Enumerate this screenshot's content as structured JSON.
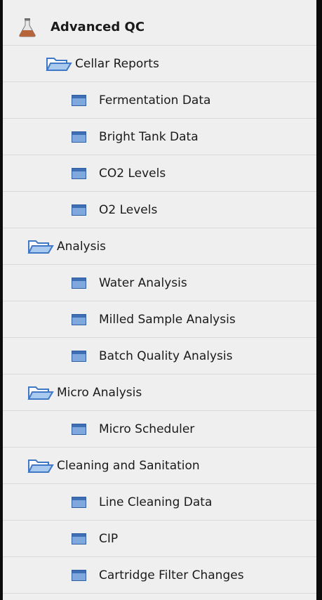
{
  "tree": {
    "root": {
      "label": "Advanced QC",
      "icon": "flask-icon"
    },
    "groups": [
      {
        "label": "Cellar Reports",
        "icon": "open-folder-icon",
        "items": [
          {
            "label": "Fermentation Data",
            "icon": "window-icon"
          },
          {
            "label": "Bright Tank Data",
            "icon": "window-icon"
          },
          {
            "label": "CO2 Levels",
            "icon": "window-icon"
          },
          {
            "label": "O2 Levels",
            "icon": "window-icon"
          }
        ]
      },
      {
        "label": "Analysis",
        "icon": "open-folder-icon",
        "items": [
          {
            "label": "Water Analysis",
            "icon": "window-icon"
          },
          {
            "label": "Milled Sample Analysis",
            "icon": "window-icon"
          },
          {
            "label": "Batch Quality Analysis",
            "icon": "window-icon"
          }
        ]
      },
      {
        "label": "Micro Analysis",
        "icon": "open-folder-icon",
        "items": [
          {
            "label": "Micro Scheduler",
            "icon": "window-icon"
          }
        ]
      },
      {
        "label": "Cleaning and Sanitation",
        "icon": "open-folder-icon",
        "items": [
          {
            "label": "Line Cleaning Data",
            "icon": "window-icon"
          },
          {
            "label": "CIP",
            "icon": "window-icon"
          },
          {
            "label": "Cartridge Filter Changes",
            "icon": "window-icon"
          }
        ]
      }
    ]
  },
  "colors": {
    "panel_background": "#efefef",
    "border": "#0b0b0b",
    "window_icon_blue": "#5b8fd0",
    "folder_blue": "#3e78c6",
    "flask_copper": "#b8643a"
  }
}
